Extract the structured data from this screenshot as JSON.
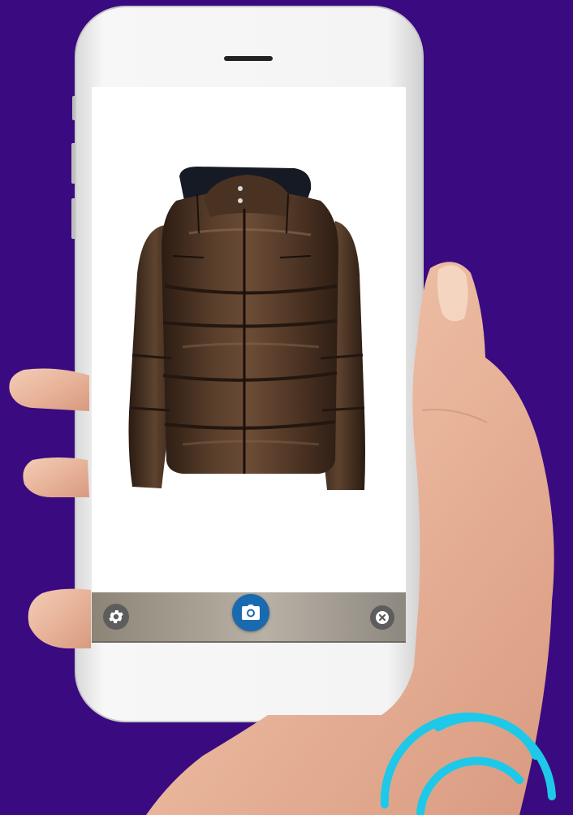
{
  "scene": {
    "background_color": "#3a0a80",
    "phone_color": "#f2f2f2",
    "logo_color": "#1ec8e8"
  },
  "screen": {
    "product_image": "brown-leather-puffer-jacket",
    "screen_background": "#ffffff"
  },
  "toolbar": {
    "settings_icon": "gear-icon",
    "camera_icon": "camera-icon",
    "close_icon": "close-circle-icon",
    "camera_button_color": "#1a6ab0"
  }
}
